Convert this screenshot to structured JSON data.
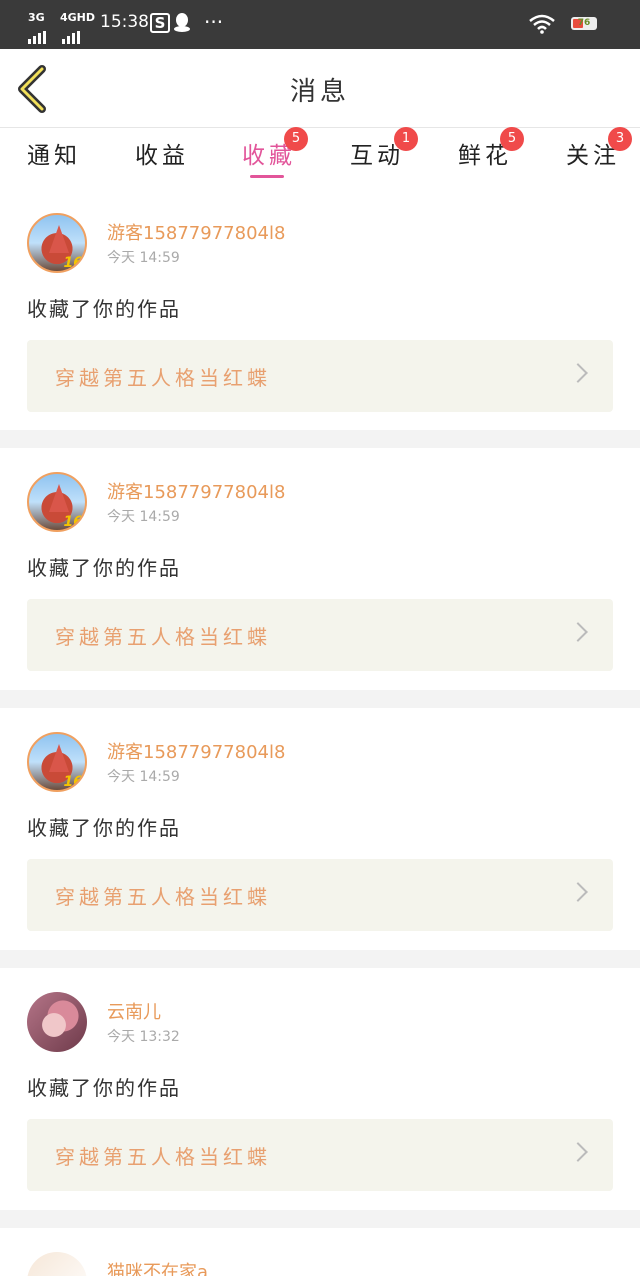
{
  "statusbar": {
    "network1": "3G",
    "network2": "4GHD",
    "time": "15:38",
    "more": "···",
    "battery": "76"
  },
  "header": {
    "title": "消息"
  },
  "tabs": [
    {
      "label": "通知",
      "badge": ""
    },
    {
      "label": "收益",
      "badge": ""
    },
    {
      "label": "收藏",
      "badge": "5",
      "active": true
    },
    {
      "label": "互动",
      "badge": "1"
    },
    {
      "label": "鲜花",
      "badge": "5"
    },
    {
      "label": "关注",
      "badge": "3"
    }
  ],
  "cards": [
    {
      "user": "游客15877977804l8",
      "time": "今天 14:59",
      "action": "收藏了你的作品",
      "work": "穿越第五人格当红蝶",
      "avatar": "avatar-landmark"
    },
    {
      "user": "游客15877977804l8",
      "time": "今天 14:59",
      "action": "收藏了你的作品",
      "work": "穿越第五人格当红蝶",
      "avatar": "avatar-landmark"
    },
    {
      "user": "游客15877977804l8",
      "time": "今天 14:59",
      "action": "收藏了你的作品",
      "work": "穿越第五人格当红蝶",
      "avatar": "avatar-landmark"
    },
    {
      "user": "云南儿",
      "time": "今天 13:32",
      "action": "收藏了你的作品",
      "work": "穿越第五人格当红蝶",
      "avatar": "avatar-pink"
    },
    {
      "user": "猫咪不在家a",
      "time": "",
      "action": "",
      "work": "",
      "avatar": "avatar-cat"
    }
  ],
  "colors": {
    "accent": "#e2559a",
    "badge": "#f04a4a",
    "username": "#e89a5a",
    "workTitle": "#e8a070"
  }
}
